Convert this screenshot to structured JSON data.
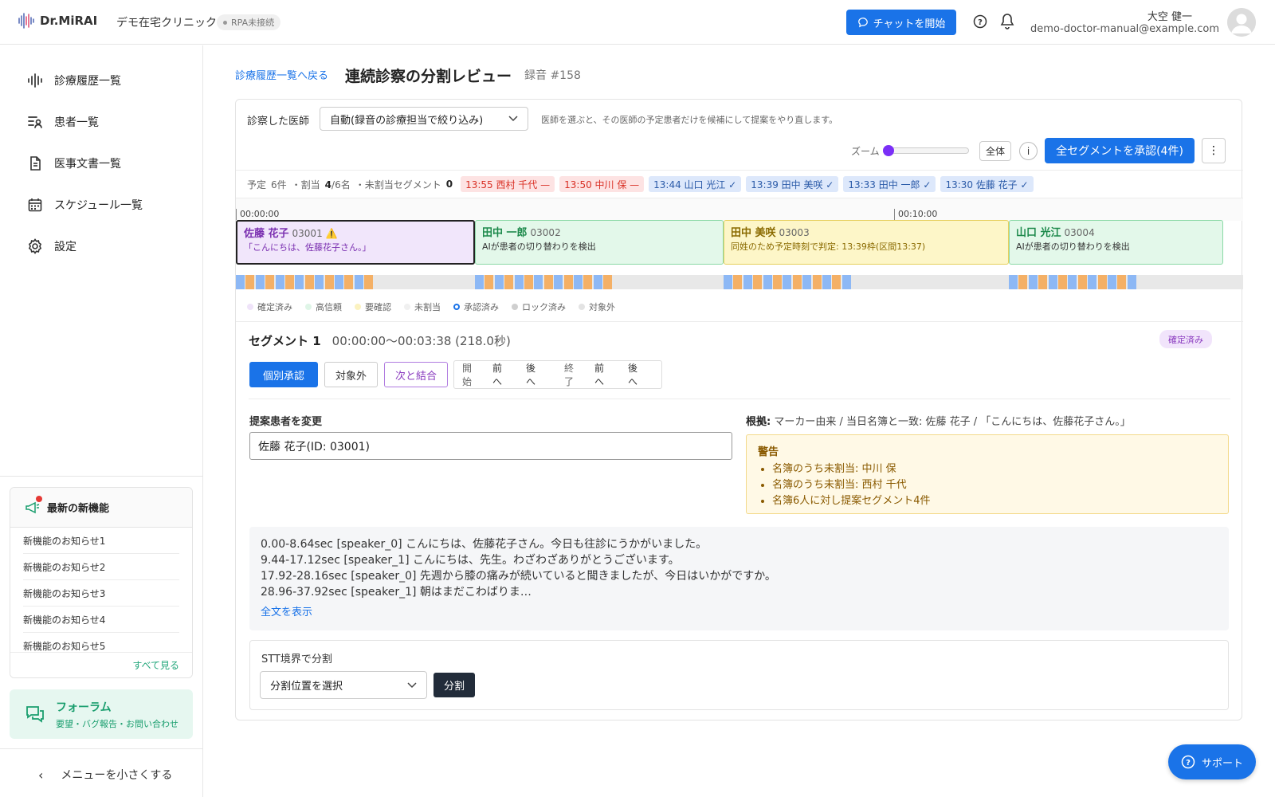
{
  "header": {
    "logo": "Dr.MiRAI",
    "clinic": "デモ在宅クリニック",
    "rpa_status": "RPA未接続",
    "chat_button": "チャットを開始",
    "user_name": "大空 健一",
    "user_email": "demo-doctor-manual@example.com"
  },
  "sidebar": {
    "items": [
      {
        "label": "診療履歴一覧",
        "icon": "waveform-icon"
      },
      {
        "label": "患者一覧",
        "icon": "patient-list-icon"
      },
      {
        "label": "医事文書一覧",
        "icon": "document-icon"
      },
      {
        "label": "スケジュール一覧",
        "icon": "calendar-icon"
      },
      {
        "label": "設定",
        "icon": "gear-icon"
      }
    ],
    "news_title": "最新の新機能",
    "news_items": [
      "新機能のお知らせ1",
      "新機能のお知らせ2",
      "新機能のお知らせ3",
      "新機能のお知らせ4",
      "新機能のお知らせ5"
    ],
    "news_all": "すべて見る",
    "forum_title": "フォーラム",
    "forum_sub": "要望・バグ報告・お問い合わせ",
    "collapse": "メニューを小さくする"
  },
  "page": {
    "breadcrumb": "診療履歴一覧へ戻る",
    "title": "連続診察の分割レビュー",
    "recording": "録音 #158"
  },
  "controls": {
    "doctor_label": "診察した医師",
    "doctor_value": "自動(録音の診療担当で絞り込み)",
    "doctor_hint": "医師を選ぶと、その医師の予定患者だけを候補にして提案をやり直します。",
    "zoom_label": "ズーム",
    "zoom_level": 0,
    "all_button": "全体",
    "info_button": "i",
    "approve_all": "全セグメントを承認(4件)",
    "more": "⋮"
  },
  "stats": {
    "scheduled_label": "予定",
    "scheduled": "6件",
    "assigned_label": "・割当",
    "assigned": "4",
    "assigned_total": "/6名",
    "unassigned_label": "・未割当セグメント",
    "unassigned": "0",
    "chips": [
      {
        "text": "13:55 西村 千代 —",
        "kind": "red"
      },
      {
        "text": "13:50 中川 保 —",
        "kind": "red"
      },
      {
        "text": "13:44 山口 光江 ✓",
        "kind": "blue"
      },
      {
        "text": "13:39 田中 美咲 ✓",
        "kind": "blue"
      },
      {
        "text": "13:33 田中 一郎 ✓",
        "kind": "blue"
      },
      {
        "text": "13:30 佐藤 花子 ✓",
        "kind": "blue"
      }
    ]
  },
  "timeline": {
    "ticks": [
      "00:00:00",
      "00:10:00"
    ],
    "segments": [
      {
        "name": "佐藤 花子",
        "id": "03001",
        "flag": "⚠️",
        "desc": "「こんにちは、佐藤花子さん。」",
        "bg": "#f1e6fb",
        "border": "#222",
        "nameColor": "#7a2fb0",
        "descColor": "#7a2fb0"
      },
      {
        "name": "田中 一郎",
        "id": "03002",
        "flag": "",
        "desc": "AIが患者の切り替わりを検出",
        "bg": "#e3f8ea",
        "border": "#8bd9a6",
        "nameColor": "#1e8a4c",
        "descColor": "#333"
      },
      {
        "name": "田中 美咲",
        "id": "03003",
        "flag": "",
        "desc": "同姓のため予定時刻で判定: 13:39枠(区間13:37)",
        "bg": "#fdf6c8",
        "border": "#e6cf5c",
        "nameColor": "#8a6a00",
        "descColor": "#8a6a00"
      },
      {
        "name": "山口 光江",
        "id": "03004",
        "flag": "",
        "desc": "AIが患者の切り替わりを検出",
        "bg": "#e3f8ea",
        "border": "#8bd9a6",
        "nameColor": "#1e8a4c",
        "descColor": "#333"
      }
    ],
    "legend": [
      {
        "label": "確定済み",
        "color": "#efe3f9",
        "ring": false
      },
      {
        "label": "高信頼",
        "color": "#dff5e7",
        "ring": false
      },
      {
        "label": "要確認",
        "color": "#fbf2c0",
        "ring": false
      },
      {
        "label": "未割当",
        "color": "#f0f0f0",
        "ring": false
      },
      {
        "label": "承認済み",
        "color": "#1a73e8",
        "ring": true
      },
      {
        "label": "ロック済み",
        "color": "#cfcfcf",
        "ring": false
      },
      {
        "label": "対象外",
        "color": "#e3e3e3",
        "ring": false
      }
    ]
  },
  "segment": {
    "title": "セグメント 1",
    "range": "00:00:00〜00:03:38 (218.0秒)",
    "status": "確定済み",
    "approve": "個別承認",
    "exclude": "対象外",
    "merge": "次と結合",
    "start": "開始",
    "end": "終了",
    "prev": "前へ",
    "next": "後へ",
    "change_label": "提案患者を変更",
    "patient_value": "佐藤 花子(ID: 03001)",
    "basis_label": "根拠:",
    "basis_text": "マーカー由来 / 当日名簿と一致: 佐藤 花子 / 「こんにちは、佐藤花子さん。」",
    "warning_title": "警告",
    "warnings": [
      "名簿のうち未割当: 中川 保",
      "名簿のうち未割当: 西村 千代",
      "名簿6人に対し提案セグメント4件"
    ],
    "transcript": [
      "0.00-8.64sec [speaker_0] こんにちは、佐藤花子さん。今日も往診にうかがいました。",
      "9.44-17.12sec [speaker_1] こんにちは、先生。わざわざありがとうございます。",
      "17.92-28.16sec [speaker_0] 先週から膝の痛みが続いていると聞きましたが、今日はいかがですか。",
      "28.96-37.92sec [speaker_1] 朝はまだこわばりま…"
    ],
    "show_all": "全文を表示",
    "stt_title": "STT境界で分割",
    "stt_select": "分割位置を選択",
    "stt_button": "分割"
  },
  "support": "サポート"
}
